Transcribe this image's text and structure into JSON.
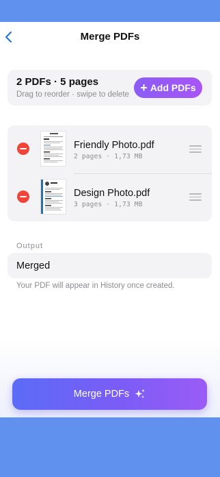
{
  "nav": {
    "title": "Merge PDFs",
    "back_icon": "chevron-left-icon"
  },
  "summary": {
    "title": "2 PDFs · 5 pages",
    "subtitle": "Drag to reorder · swipe to delete",
    "add_button_label": "Add PDFs"
  },
  "files": [
    {
      "name": "Friendly Photo.pdf",
      "meta": "2 pages · 1,73 MB"
    },
    {
      "name": "Design Photo.pdf",
      "meta": "3 pages · 1,73 MB"
    }
  ],
  "output": {
    "label": "Output",
    "value": "Merged",
    "hint": "Your PDF will appear in History once created."
  },
  "merge_button_label": "Merge PDFs",
  "colors": {
    "accent": "#8b5cf6",
    "link": "#1f7ae0",
    "destructive": "#f04438",
    "frame": "#6191ef"
  }
}
